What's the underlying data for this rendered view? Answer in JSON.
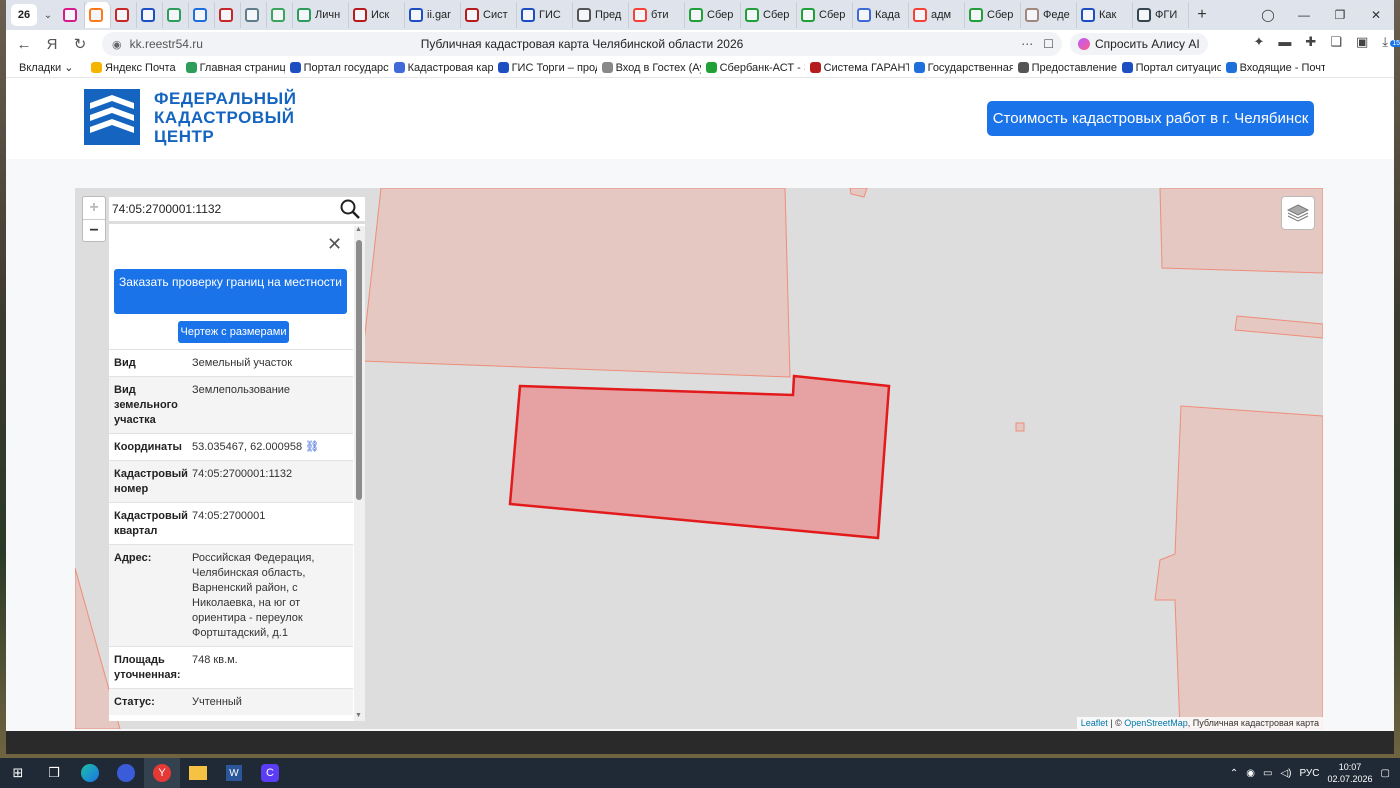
{
  "browser": {
    "tab_count": "26",
    "tabs": [
      {
        "label": "",
        "icon": "video-icon",
        "color": "#d81b8c"
      },
      {
        "label": "",
        "icon": "home-icon",
        "color": "#ff7a1a",
        "active": true
      },
      {
        "label": "",
        "icon": "flag-icon",
        "color": "#c62828"
      },
      {
        "label": "",
        "icon": "flag-icon",
        "color": "#1e4fc2"
      },
      {
        "label": "",
        "icon": "check-icon",
        "color": "#2e9d5b"
      },
      {
        "label": "",
        "icon": "building-icon",
        "color": "#1e6fd9"
      },
      {
        "label": "",
        "icon": "flag-icon",
        "color": "#c62828"
      },
      {
        "label": "",
        "icon": "calculator-icon",
        "color": "#607d8b"
      },
      {
        "label": "",
        "icon": "m-icon",
        "color": "#3aa55c"
      },
      {
        "label": "Личн",
        "icon": "check-icon",
        "color": "#2e9d5b"
      },
      {
        "label": "Иск",
        "icon": "eagle-icon",
        "color": "#b71c1c"
      },
      {
        "label": "ii.gar",
        "icon": "eagle-icon",
        "color": "#1e4fc2"
      },
      {
        "label": "Сист",
        "icon": "eagle-icon",
        "color": "#b71c1c"
      },
      {
        "label": "ГИС",
        "icon": "eagle-icon",
        "color": "#1e4fc2"
      },
      {
        "label": "Пред",
        "icon": "globe-icon",
        "color": "#555555"
      },
      {
        "label": "бти",
        "icon": "yandex-icon",
        "color": "#f44336"
      },
      {
        "label": "Сбер",
        "icon": "sber-icon",
        "color": "#21a038"
      },
      {
        "label": "Сбер",
        "icon": "sber-icon",
        "color": "#21a038"
      },
      {
        "label": "Сбер",
        "icon": "sber-icon",
        "color": "#21a038"
      },
      {
        "label": "Када",
        "icon": "map-icon",
        "color": "#3f6ad8"
      },
      {
        "label": "адм",
        "icon": "yandex-icon",
        "color": "#f44336"
      },
      {
        "label": "Сбер",
        "icon": "sber-icon",
        "color": "#21a038"
      },
      {
        "label": "Феде",
        "icon": "avatar-icon",
        "color": "#a1887f"
      },
      {
        "label": "Как",
        "icon": "star-icon",
        "color": "#1e4fc2"
      },
      {
        "label": "ФГИ",
        "icon": "shield-icon",
        "color": "#37474f"
      }
    ],
    "url": "kk.reestr54.ru",
    "page_title": "Публичная кадастровая карта Челябинской области 2026",
    "alice_label": "Спросить Алису AI",
    "download_badge": "15",
    "bookmarks": [
      {
        "label": "Вкладки",
        "icon": "chevron-down-icon"
      },
      {
        "label": "Яндекс Почта",
        "icon": "mail-icon",
        "color": "#f5b400"
      },
      {
        "label": "Главная страница",
        "icon": "check-icon",
        "color": "#2e9d5b"
      },
      {
        "label": "Портал государст",
        "icon": "flag-icon",
        "color": "#1e4fc2"
      },
      {
        "label": "Кадастровая карт",
        "icon": "map-icon",
        "color": "#3f6ad8"
      },
      {
        "label": "ГИС Торги – прод",
        "icon": "eagle-icon",
        "color": "#1e4fc2"
      },
      {
        "label": "Вход в Гостех (Ау",
        "icon": "doc-icon",
        "color": "#888888"
      },
      {
        "label": "Сбербанк-АСТ - Э",
        "icon": "sber-icon",
        "color": "#21a038"
      },
      {
        "label": "Система ГАРАНТ",
        "icon": "eagle-icon",
        "color": "#b71c1c"
      },
      {
        "label": "Государственная",
        "icon": "building-icon",
        "color": "#1e6fd9"
      },
      {
        "label": "Предоставление",
        "icon": "globe-icon",
        "color": "#555555"
      },
      {
        "label": "Портал ситуацио",
        "icon": "flag-icon",
        "color": "#1e4fc2"
      },
      {
        "label": "Входящие - Почта",
        "icon": "mail-icon",
        "color": "#1e6fd9"
      }
    ]
  },
  "site": {
    "logo_lines": [
      "ФЕДЕРАЛЬНЫЙ",
      "КАДАСТРОВЫЙ",
      "ЦЕНТР"
    ],
    "cost_button": "Стоимость кадастровых работ в г. Челябинск"
  },
  "map": {
    "search_query": "74:05:2700001:1132",
    "zoom_in": "+",
    "zoom_out": "−",
    "attribution": {
      "leaflet": "Leaflet",
      "sep": " | © ",
      "osm": "OpenStreetMap",
      "rest": ", Публичная кадастровая карта"
    }
  },
  "panel": {
    "order_button": "Заказать проверку границ на местности",
    "drawing_button": "Чертеж с размерами",
    "rows": [
      {
        "key": "Вид",
        "value": "Земельный участок"
      },
      {
        "key": "Вид земельного участка",
        "value": "Землепользование"
      },
      {
        "key": "Координаты",
        "value": "53.035467, 62.000958"
      },
      {
        "key": "Кадастровый номер",
        "value": "74:05:2700001:1132"
      },
      {
        "key": "Кадастровый квартал",
        "value": "74:05:2700001"
      },
      {
        "key": "Адрес:",
        "value": "Российская Федерация, Челябинская область, Варненский район, с Николаевка, на юг от ориентира - переулок Фортштадский, д.1"
      },
      {
        "key": "Площадь уточненная:",
        "value": "748 кв.м."
      },
      {
        "key": "Статус:",
        "value": "Учтенный"
      }
    ]
  },
  "taskbar": {
    "language": "РУС",
    "time": "10:07",
    "date": "02.07.2026"
  },
  "colors": {
    "accent": "#1a73e8",
    "parcel_fill": "#e5c8c2",
    "parcel_stroke": "#ee8d7a",
    "selected_fill": "#e6a2a2",
    "selected_stroke": "#e31a1c"
  }
}
